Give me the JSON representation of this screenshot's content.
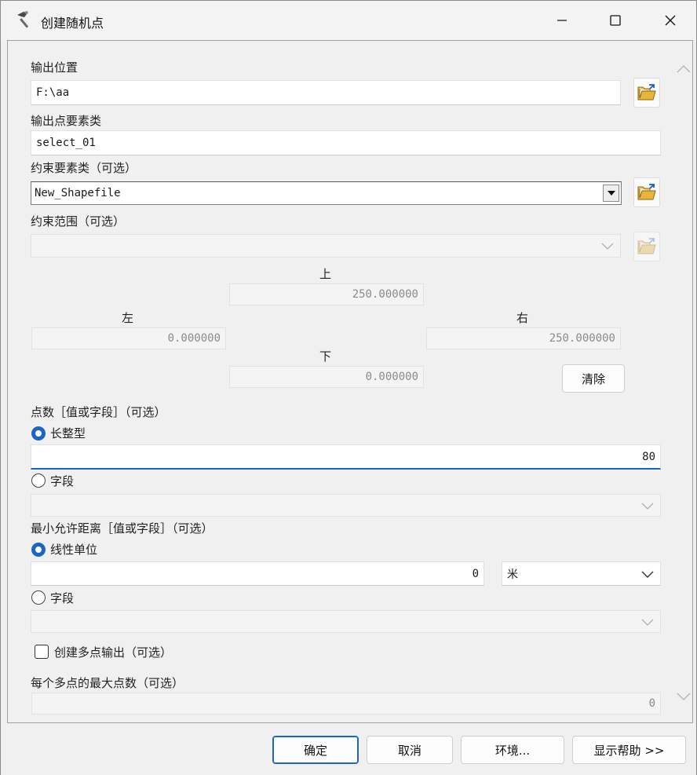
{
  "window": {
    "title": "创建随机点",
    "icon": "hammer-icon"
  },
  "output_location": {
    "label": "输出位置",
    "value": "F:\\aa"
  },
  "output_class": {
    "label": "输出点要素类",
    "value": "select_01"
  },
  "constraint_class": {
    "label": "约束要素类（可选）",
    "value": "New_Shapefile"
  },
  "constraint_extent": {
    "label": "约束范围（可选）",
    "value": "",
    "top_label": "上",
    "top_value": "250.000000",
    "left_label": "左",
    "left_value": "0.000000",
    "right_label": "右",
    "right_value": "250.000000",
    "bottom_label": "下",
    "bottom_value": "0.000000",
    "clear_label": "清除"
  },
  "point_count": {
    "label": "点数［值或字段］（可选）",
    "option_long": "长整型",
    "long_value": "80",
    "option_field": "字段",
    "field_value": ""
  },
  "min_distance": {
    "label": "最小允许距离［值或字段］（可选）",
    "option_linear": "线性单位",
    "linear_value": "0",
    "unit_value": "米",
    "option_field": "字段",
    "field_value": ""
  },
  "multipoint": {
    "checkbox_label": "创建多点输出（可选）",
    "checked": false,
    "max_label": "每个多点的最大点数（可选）",
    "max_value": "0"
  },
  "footer": {
    "ok_label": "确定",
    "cancel_label": "取消",
    "env_label": "环境...",
    "help_label": "显示帮助 >>"
  },
  "colors": {
    "accent": "#1b66c0",
    "background": "#f0f0f0"
  }
}
